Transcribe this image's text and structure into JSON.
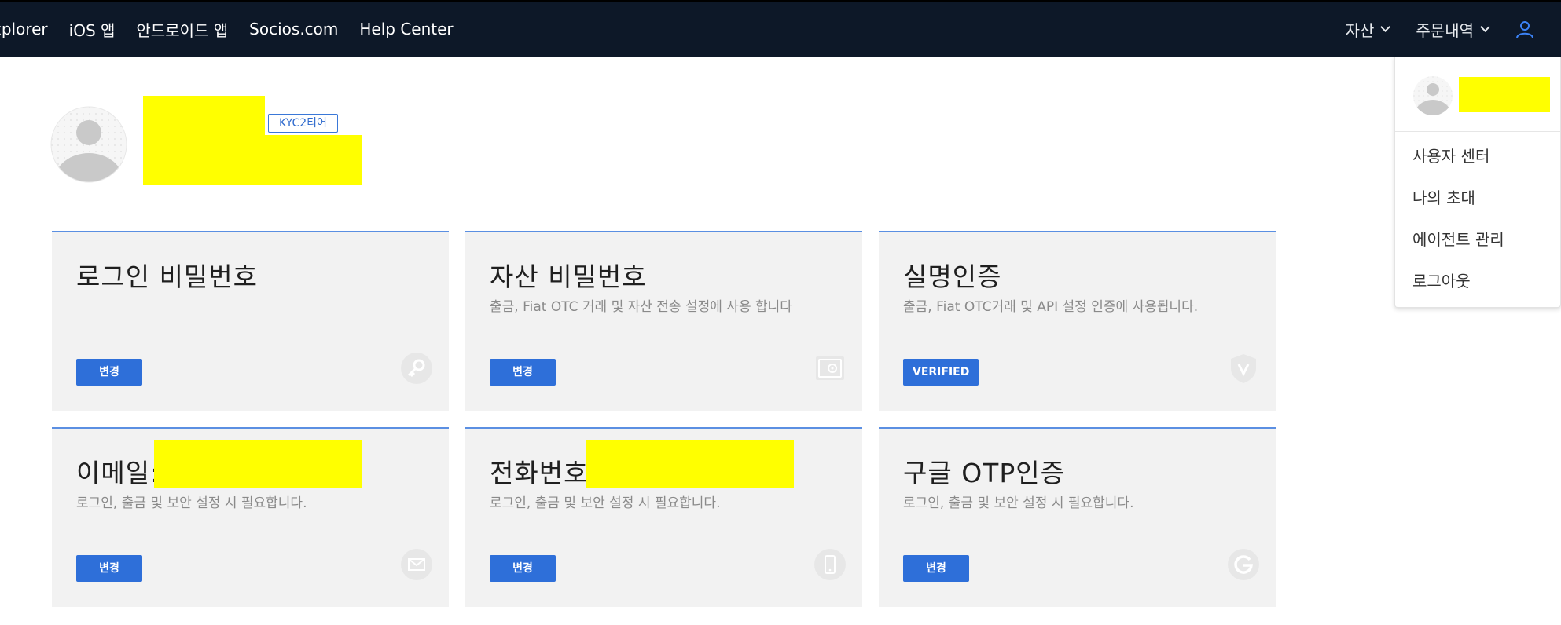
{
  "nav": {
    "links": [
      "xplorer",
      "iOS 앱",
      "안드로이드 앱",
      "Socios.com",
      "Help Center"
    ],
    "dropdowns": [
      "자산",
      "주문내역"
    ],
    "user_icon": "user-icon"
  },
  "user_menu": {
    "items": [
      "사용자 센터",
      "나의 초대",
      "에이전트 관리",
      "로그아웃"
    ]
  },
  "profile": {
    "kyc_badge": "KYC2티어"
  },
  "cards": [
    {
      "title": "로그인 비밀번호",
      "desc": "",
      "button": "변경",
      "icon": "key-icon"
    },
    {
      "title": "자산 비밀번호",
      "desc": "출금, Fiat OTC 거래 및 자산 전송 설정에 사용 합니다",
      "button": "변경",
      "icon": "safe-icon"
    },
    {
      "title": "실명인증",
      "desc": "출금, Fiat OTC거래 및 API 설정 인증에 사용됩니다.",
      "button": "VERIFIED",
      "icon": "shield-icon"
    },
    {
      "title": "이메일:",
      "desc": "로그인, 출금 및 보안 설정 시 필요합니다.",
      "button": "변경",
      "icon": "mail-icon"
    },
    {
      "title": "전화번호",
      "desc": "로그인, 출금 및 보안 설정 시 필요합니다.",
      "button": "변경",
      "icon": "phone-icon"
    },
    {
      "title": "구글 OTP인증",
      "desc": "로그인, 출금 및 보안 설정 시 필요합니다.",
      "button": "변경",
      "icon": "google-icon"
    }
  ],
  "colors": {
    "topbar": "#0d1828",
    "accent": "#2e6fd9",
    "card_bg": "#f2f2f2",
    "redaction": "#ffff00"
  }
}
